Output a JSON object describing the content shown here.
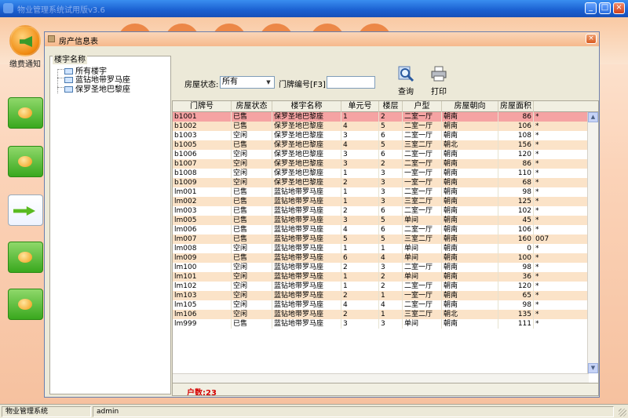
{
  "window": {
    "title": "物业管理系统试用版v3.6"
  },
  "sidebar": {
    "notice_label": "缴费通知"
  },
  "statusbar": {
    "app_name": "物业管理系统",
    "user": "admin"
  },
  "dialog": {
    "title": "房产信息表",
    "tree": {
      "legend": "楼宇名称",
      "items": [
        {
          "label": "所有楼宇"
        },
        {
          "label": "蓝钻地带罗马座"
        },
        {
          "label": "保罗圣地巴黎座"
        }
      ]
    },
    "filter": {
      "status_label": "房屋状态:",
      "status_value": "所有",
      "door_label": "门牌编号[F3]:",
      "door_value": ""
    },
    "buttons": {
      "query": "查询",
      "print": "打印"
    },
    "grid": {
      "columns": [
        "门牌号",
        "房屋状态",
        "楼宇名称",
        "单元号",
        "楼层",
        "户型",
        "房屋朝向",
        "房屋面积"
      ],
      "rows": [
        [
          "b1001",
          "已售",
          "保罗圣地巴黎座",
          "1",
          "2",
          "二室一厅",
          "朝南",
          "86",
          "*"
        ],
        [
          "b1002",
          "已售",
          "保罗圣地巴黎座",
          "4",
          "5",
          "二室一厅",
          "朝南",
          "106",
          "*"
        ],
        [
          "b1003",
          "空闲",
          "保罗圣地巴黎座",
          "3",
          "6",
          "二室一厅",
          "朝南",
          "108",
          "*"
        ],
        [
          "b1005",
          "已售",
          "保罗圣地巴黎座",
          "4",
          "5",
          "三室二厅",
          "朝北",
          "156",
          "*"
        ],
        [
          "b1006",
          "空闲",
          "保罗圣地巴黎座",
          "3",
          "6",
          "二室一厅",
          "朝南",
          "120",
          "*"
        ],
        [
          "b1007",
          "空闲",
          "保罗圣地巴黎座",
          "3",
          "2",
          "二室一厅",
          "朝南",
          "86",
          "*"
        ],
        [
          "b1008",
          "空闲",
          "保罗圣地巴黎座",
          "1",
          "3",
          "一室一厅",
          "朝南",
          "110",
          "*"
        ],
        [
          "b1009",
          "空闲",
          "保罗圣地巴黎座",
          "2",
          "3",
          "一室一厅",
          "朝南",
          "68",
          "*"
        ],
        [
          "lm001",
          "已售",
          "蓝钻地带罗马座",
          "1",
          "3",
          "二室一厅",
          "朝南",
          "98",
          "*"
        ],
        [
          "lm002",
          "已售",
          "蓝钻地带罗马座",
          "1",
          "3",
          "三室二厅",
          "朝南",
          "125",
          "*"
        ],
        [
          "lm003",
          "已售",
          "蓝钻地带罗马座",
          "2",
          "6",
          "二室一厅",
          "朝南",
          "102",
          "*"
        ],
        [
          "lm005",
          "已售",
          "蓝钻地带罗马座",
          "3",
          "5",
          "单间",
          "朝南",
          "45",
          "*"
        ],
        [
          "lm006",
          "已售",
          "蓝钻地带罗马座",
          "4",
          "6",
          "二室一厅",
          "朝南",
          "106",
          "*"
        ],
        [
          "lm007",
          "已售",
          "蓝钻地带罗马座",
          "5",
          "5",
          "三室二厅",
          "朝南",
          "160",
          "007"
        ],
        [
          "lm008",
          "空闲",
          "蓝钻地带罗马座",
          "1",
          "1",
          "单间",
          "朝南",
          "0",
          "*"
        ],
        [
          "lm009",
          "已售",
          "蓝钻地带罗马座",
          "6",
          "4",
          "单间",
          "朝南",
          "100",
          "*"
        ],
        [
          "lm100",
          "空闲",
          "蓝钻地带罗马座",
          "2",
          "3",
          "二室一厅",
          "朝南",
          "98",
          "*"
        ],
        [
          "lm101",
          "空闲",
          "蓝钻地带罗马座",
          "1",
          "2",
          "单间",
          "朝南",
          "36",
          "*"
        ],
        [
          "lm102",
          "空闲",
          "蓝钻地带罗马座",
          "1",
          "2",
          "二室一厅",
          "朝南",
          "120",
          "*"
        ],
        [
          "lm103",
          "空闲",
          "蓝钻地带罗马座",
          "2",
          "1",
          "一室一厅",
          "朝南",
          "65",
          "*"
        ],
        [
          "lm105",
          "空闲",
          "蓝钻地带罗马座",
          "4",
          "4",
          "二室一厅",
          "朝南",
          "98",
          "*"
        ],
        [
          "lm106",
          "空闲",
          "蓝钻地带罗马座",
          "2",
          "1",
          "三室二厅",
          "朝北",
          "135",
          "*"
        ],
        [
          "lm999",
          "已售",
          "蓝钻地带罗马座",
          "3",
          "3",
          "单间",
          "朝南",
          "111",
          "*"
        ]
      ],
      "footer": "户数:23"
    }
  },
  "colors": {
    "selected_row": "#f5a3a3",
    "alt_row": "#fbe3c8",
    "normal_row": "#ffffff",
    "count_text": "#d40000"
  }
}
